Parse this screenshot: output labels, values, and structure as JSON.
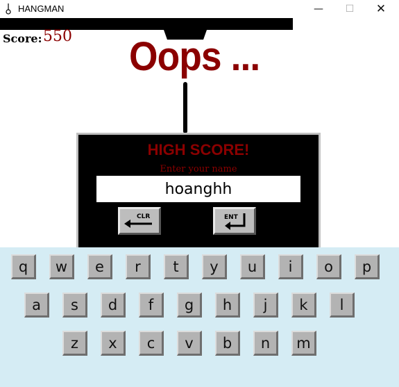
{
  "window": {
    "title": "HANGMAN",
    "minimize_glyph": "—",
    "maximize_glyph": "☐",
    "close_glyph": "✕"
  },
  "score": {
    "label": "Score:",
    "value": "550"
  },
  "banner": "Oops ...",
  "high_score_panel": {
    "title": "HIGH SCORE!",
    "prompt": "Enter your name",
    "name_value": "hoanghh",
    "clear_label": "CLR",
    "enter_label": "ENT"
  },
  "colors": {
    "accent": "#8b0000",
    "keyboard_bg": "#d5ecf4",
    "key_bg": "#b3b3b3"
  },
  "keyboard": {
    "rows": [
      [
        "q",
        "w",
        "e",
        "r",
        "t",
        "y",
        "u",
        "i",
        "o",
        "p"
      ],
      [
        "a",
        "s",
        "d",
        "f",
        "g",
        "h",
        "j",
        "k",
        "l"
      ],
      [
        "z",
        "x",
        "c",
        "v",
        "b",
        "n",
        "m"
      ]
    ]
  }
}
